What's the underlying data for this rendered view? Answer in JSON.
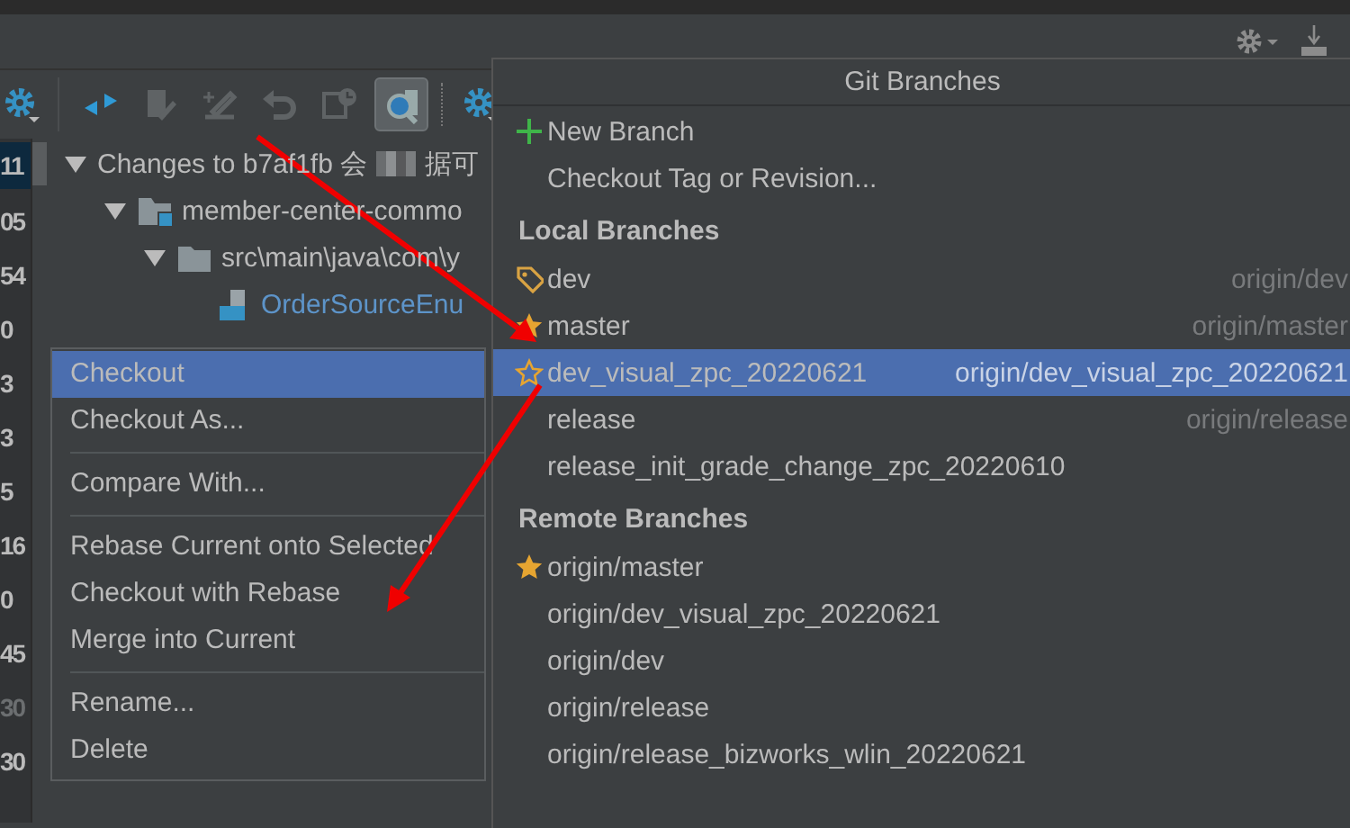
{
  "toolbar_buttons": [
    {
      "kind": "gear",
      "disabled": false,
      "selected": false
    },
    {
      "kind": "collapse",
      "disabled": false,
      "selected": false
    },
    {
      "kind": "edit",
      "disabled": true,
      "selected": false
    },
    {
      "kind": "commit",
      "disabled": true,
      "selected": false
    },
    {
      "kind": "revert",
      "disabled": true,
      "selected": false
    },
    {
      "kind": "history",
      "disabled": true,
      "selected": false
    },
    {
      "kind": "preview",
      "disabled": false,
      "selected": true
    },
    {
      "kind": "gear",
      "disabled": false,
      "selected": false
    }
  ],
  "gutter_numbers": [
    {
      "text": "11",
      "selected": true,
      "disabled": false
    },
    {
      "text": "05",
      "selected": false,
      "disabled": false
    },
    {
      "text": "54",
      "selected": false,
      "disabled": false
    },
    {
      "text": "0",
      "selected": false,
      "disabled": false
    },
    {
      "text": "3",
      "selected": false,
      "disabled": false
    },
    {
      "text": "3",
      "selected": false,
      "disabled": false
    },
    {
      "text": "5",
      "selected": false,
      "disabled": false
    },
    {
      "text": "16",
      "selected": false,
      "disabled": false
    },
    {
      "text": "0",
      "selected": false,
      "disabled": false
    },
    {
      "text": "45",
      "selected": false,
      "disabled": false
    },
    {
      "text": "30",
      "selected": false,
      "disabled": true
    },
    {
      "text": "30",
      "selected": false,
      "disabled": false
    }
  ],
  "tree": [
    {
      "label": "Changes to b7af1fb 会",
      "label_tail": "据可",
      "expanded": true,
      "children": [
        {
          "kind": "module",
          "label": "member-center-commo",
          "expanded": true,
          "children": [
            {
              "kind": "folder",
              "label": "src\\main\\java\\com\\y",
              "expanded": true,
              "children": [
                {
                  "kind": "java",
                  "label": "OrderSourceEnu"
                }
              ]
            }
          ]
        }
      ]
    }
  ],
  "context_menu": {
    "groups": [
      [
        {
          "label": "Checkout",
          "selected": true
        },
        {
          "label": "Checkout As...",
          "selected": false
        }
      ],
      [
        {
          "label": "Compare With...",
          "selected": false
        }
      ],
      [
        {
          "label": "Rebase Current onto Selected",
          "selected": false
        },
        {
          "label": "Checkout with Rebase",
          "selected": false
        },
        {
          "label": "Merge into Current",
          "selected": false
        }
      ],
      [
        {
          "label": "Rename...",
          "selected": false
        },
        {
          "label": "Delete",
          "selected": false
        }
      ]
    ]
  },
  "branches_popup": {
    "title": "Git Branches",
    "actions": [
      {
        "label": "New Branch",
        "kind": "new"
      },
      {
        "label": "Checkout Tag or Revision...",
        "kind": "plain"
      }
    ],
    "sections": [
      {
        "title": "Local Branches",
        "branches": [
          {
            "name": "dev",
            "tracking": "origin/dev",
            "kind": "tag",
            "selected": false
          },
          {
            "name": "master",
            "tracking": "origin/master",
            "kind": "star",
            "selected": false
          },
          {
            "name": "dev_visual_zpc_20220621",
            "tracking": "origin/dev_visual_zpc_20220621",
            "kind": "star_outline",
            "selected": true
          },
          {
            "name": "release",
            "tracking": "origin/release",
            "kind": "plain",
            "selected": false
          },
          {
            "name": "release_init_grade_change_zpc_20220610",
            "kind": "plain",
            "selected": false
          }
        ]
      },
      {
        "title": "Remote Branches",
        "branches": [
          {
            "name": "origin/master",
            "kind": "star",
            "selected": false
          },
          {
            "name": "origin/dev_visual_zpc_20220621",
            "kind": "plain",
            "selected": false
          },
          {
            "name": "origin/dev",
            "kind": "plain",
            "selected": false
          },
          {
            "name": "origin/release",
            "kind": "plain",
            "selected": false
          },
          {
            "name": "origin/release_bizworks_wlin_20220621",
            "kind": "plain",
            "selected": false
          }
        ]
      }
    ]
  }
}
